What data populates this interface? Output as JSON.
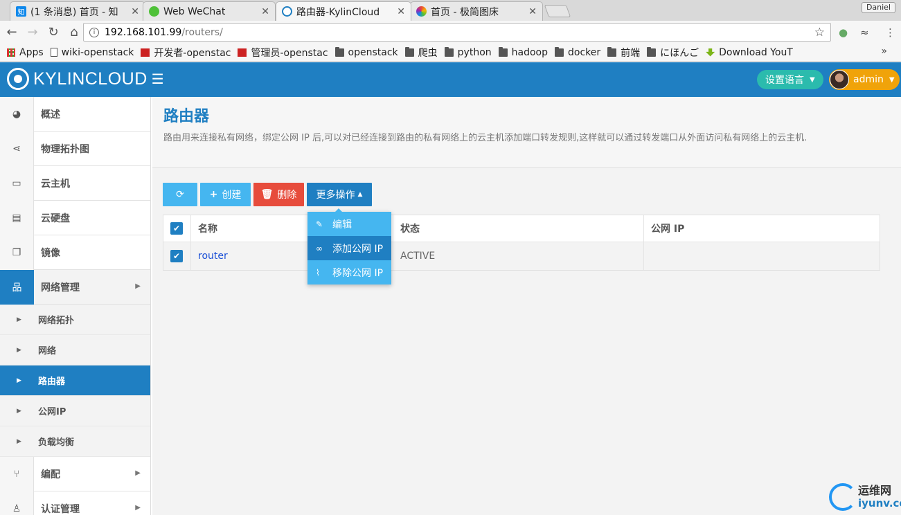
{
  "browser": {
    "tabs": [
      {
        "title": "(1 条消息) 首页 - 知",
        "favicon": "知",
        "favicon_color": "#0f88eb"
      },
      {
        "title": "Web WeChat",
        "favicon": "wechat",
        "favicon_color": "#4fc139"
      },
      {
        "title": "路由器-KylinCloud",
        "favicon": "kylin",
        "favicon_color": "#1f7fc2"
      },
      {
        "title": "首页 - 极简图床",
        "favicon": "flower",
        "favicon_color": "#e84a3a"
      }
    ],
    "profile": "Daniel",
    "url_host": "192.168.101.99",
    "url_path": "/routers/",
    "bookmarks": [
      {
        "label": "Apps",
        "icon": "apps-grid-icon"
      },
      {
        "label": "wiki-openstack",
        "icon": "page-icon"
      },
      {
        "label": "开发者-openstac",
        "icon": "openstack-icon"
      },
      {
        "label": "管理员-openstac",
        "icon": "openstack-icon"
      },
      {
        "label": "openstack",
        "icon": "folder-icon"
      },
      {
        "label": "爬虫",
        "icon": "folder-icon"
      },
      {
        "label": "python",
        "icon": "folder-icon"
      },
      {
        "label": "hadoop",
        "icon": "folder-icon"
      },
      {
        "label": "docker",
        "icon": "folder-icon"
      },
      {
        "label": "前端",
        "icon": "folder-icon"
      },
      {
        "label": "にほんご",
        "icon": "folder-icon"
      },
      {
        "label": "Download YouT",
        "icon": "download-icon"
      }
    ],
    "more": "»"
  },
  "app": {
    "logo_text": "KYLINCLOUD",
    "language_button": "设置语言",
    "user": "admin",
    "brand_color": "#1f7fc2"
  },
  "sidebar": {
    "items": [
      {
        "label": "概述",
        "icon": "dashboard-icon",
        "glyph": "◕"
      },
      {
        "label": "物理拓扑图",
        "icon": "share-icon",
        "glyph": "⋖"
      },
      {
        "label": "云主机",
        "icon": "laptop-icon",
        "glyph": "▭"
      },
      {
        "label": "云硬盘",
        "icon": "hdd-icon",
        "glyph": "▤"
      },
      {
        "label": "镜像",
        "icon": "copy-icon",
        "glyph": "❐"
      },
      {
        "label": "网络管理",
        "icon": "sitemap-icon",
        "glyph": "品"
      }
    ],
    "subitems": [
      {
        "label": "网络拓扑"
      },
      {
        "label": "网络"
      },
      {
        "label": "路由器"
      },
      {
        "label": "公网IP"
      },
      {
        "label": "负载均衡"
      }
    ],
    "items_after": [
      {
        "label": "编配",
        "icon": "code-fork-icon",
        "glyph": "⑂"
      },
      {
        "label": "认证管理",
        "icon": "user-icon",
        "glyph": "♙"
      }
    ]
  },
  "page": {
    "title": "路由器",
    "description": "路由用来连接私有网络，绑定公网 IP 后,可以对已经连接到路由的私有网络上的云主机添加端口转发规则,这样就可以通过转发端口从外面访问私有网络上的云主机."
  },
  "actions": {
    "create": "创建",
    "delete": "删除",
    "more": "更多操作"
  },
  "dropdown": [
    {
      "label": "编辑",
      "icon": "edit-icon",
      "glyph": "✎"
    },
    {
      "label": "添加公网 IP",
      "icon": "link-icon",
      "glyph": "∞"
    },
    {
      "label": "移除公网 IP",
      "icon": "unlink-icon",
      "glyph": "⌇"
    }
  ],
  "table": {
    "columns": [
      "名称",
      "状态",
      "公网 IP"
    ],
    "rows": [
      {
        "name": "router",
        "status": "ACTIVE",
        "public_ip": ""
      }
    ]
  },
  "watermark": {
    "cn": "运维网",
    "en": "iyunv.com"
  }
}
